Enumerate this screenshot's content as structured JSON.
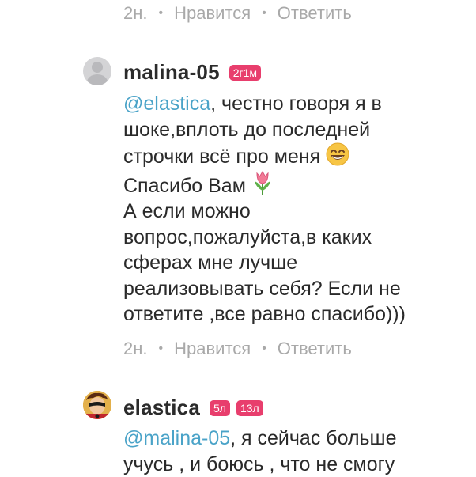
{
  "colors": {
    "accent_mention": "#4aa3c8",
    "badge": "#e83e6d",
    "meta_text": "#a9a9a9"
  },
  "top_meta": {
    "time": "2н.",
    "like": "Нравится",
    "reply": "Ответить"
  },
  "comments": [
    {
      "avatar_icon": "default-user-avatar-icon",
      "username": "malina-05",
      "badges": [
        "2г1м"
      ],
      "mention": "@elastica",
      "lines": [
        ", честно говоря я в",
        "шоке,вплоть до последней",
        "строчки всё про меня",
        "Спасибо Вам",
        "А если можно",
        "вопрос,пожалуйста,в каких",
        "сферах мне лучше",
        "реализовывать себя? Если не",
        "ответите ,все равно спасибо)))"
      ],
      "emojis": [
        "grinning-face-icon",
        "tulip-icon"
      ],
      "meta": {
        "time": "2н.",
        "like": "Нравится",
        "reply": "Ответить"
      }
    },
    {
      "avatar_icon": "superhero-avatar-icon",
      "username": "elastica",
      "badges": [
        "5л",
        "13л"
      ],
      "mention": "@malina-05",
      "lines": [
        ", я сейчас больше",
        "учусь , и боюсь ,  что не смогу"
      ]
    }
  ]
}
